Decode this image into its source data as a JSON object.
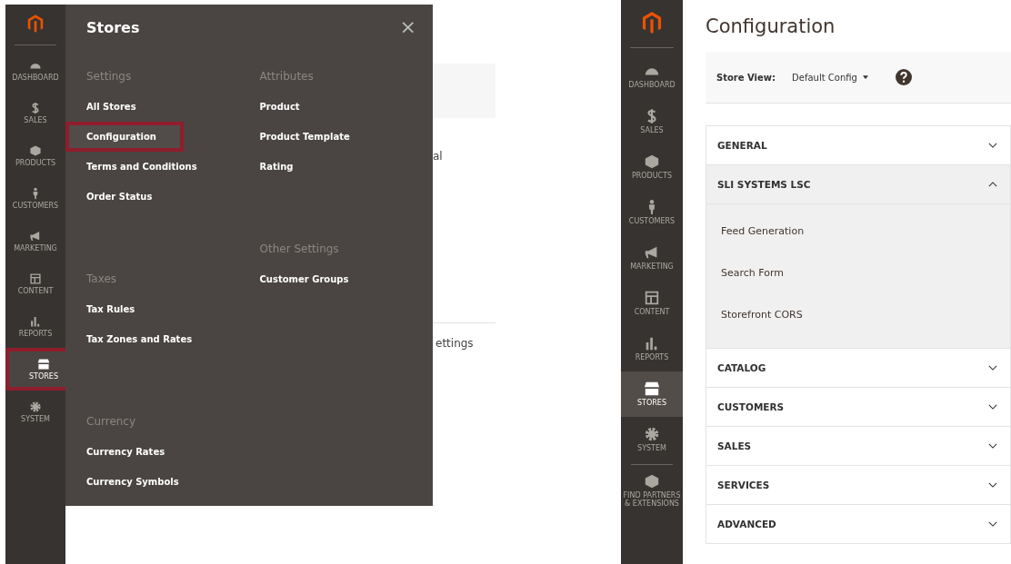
{
  "left_screen": {
    "sidebar": {
      "items": [
        {
          "label": "DASHBOARD",
          "selected": false,
          "highlighted": false
        },
        {
          "label": "SALES",
          "selected": false,
          "highlighted": false
        },
        {
          "label": "PRODUCTS",
          "selected": false,
          "highlighted": false
        },
        {
          "label": "CUSTOMERS",
          "selected": false,
          "highlighted": false
        },
        {
          "label": "MARKETING",
          "selected": false,
          "highlighted": false
        },
        {
          "label": "CONTENT",
          "selected": false,
          "highlighted": false
        },
        {
          "label": "REPORTS",
          "selected": false,
          "highlighted": false
        },
        {
          "label": "STORES",
          "selected": true,
          "highlighted": true
        },
        {
          "label": "SYSTEM",
          "selected": false,
          "highlighted": false
        }
      ]
    },
    "flyout": {
      "title": "Stores",
      "close": "×",
      "columns": [
        [
          {
            "heading": "Settings",
            "links": [
              {
                "label": "All Stores",
                "highlighted": false
              },
              {
                "label": "Configuration",
                "highlighted": true
              },
              {
                "label": "Terms and Conditions",
                "highlighted": false
              },
              {
                "label": "Order Status",
                "highlighted": false
              }
            ]
          },
          {
            "heading": "Taxes",
            "links": [
              {
                "label": "Tax Rules",
                "highlighted": false
              },
              {
                "label": "Tax Zones and Rates",
                "highlighted": false
              }
            ]
          },
          {
            "heading": "Currency",
            "links": [
              {
                "label": "Currency Rates",
                "highlighted": false
              },
              {
                "label": "Currency Symbols",
                "highlighted": false
              }
            ]
          }
        ],
        [
          {
            "heading": "Attributes",
            "links": [
              {
                "label": "Product",
                "highlighted": false
              },
              {
                "label": "Product Template",
                "highlighted": false
              },
              {
                "label": "Rating",
                "highlighted": false
              }
            ]
          },
          {
            "heading": "Other Settings",
            "links": [
              {
                "label": "Customer Groups",
                "highlighted": false
              }
            ]
          }
        ]
      ]
    },
    "background_texts": [
      "al",
      "ettings"
    ]
  },
  "right_screen": {
    "sidebar": {
      "items": [
        {
          "label": "DASHBOARD",
          "selected": false
        },
        {
          "label": "SALES",
          "selected": false
        },
        {
          "label": "PRODUCTS",
          "selected": false
        },
        {
          "label": "CUSTOMERS",
          "selected": false
        },
        {
          "label": "MARKETING",
          "selected": false
        },
        {
          "label": "CONTENT",
          "selected": false
        },
        {
          "label": "REPORTS",
          "selected": false
        },
        {
          "label": "STORES",
          "selected": true
        },
        {
          "label": "SYSTEM",
          "selected": false
        },
        {
          "label": "FIND PARTNERS & EXTENSIONS",
          "selected": false
        }
      ]
    },
    "page_title": "Configuration",
    "store_view": {
      "label": "Store View:",
      "value": "Default Config"
    },
    "sections": [
      {
        "title": "GENERAL",
        "expanded": false
      },
      {
        "title": "SLI SYSTEMS LSC",
        "expanded": true,
        "children": [
          "Feed Generation",
          "Search Form",
          "Storefront CORS"
        ]
      },
      {
        "title": "CATALOG",
        "expanded": false
      },
      {
        "title": "CUSTOMERS",
        "expanded": false
      },
      {
        "title": "SALES",
        "expanded": false
      },
      {
        "title": "SERVICES",
        "expanded": false
      },
      {
        "title": "ADVANCED",
        "expanded": false
      }
    ]
  }
}
